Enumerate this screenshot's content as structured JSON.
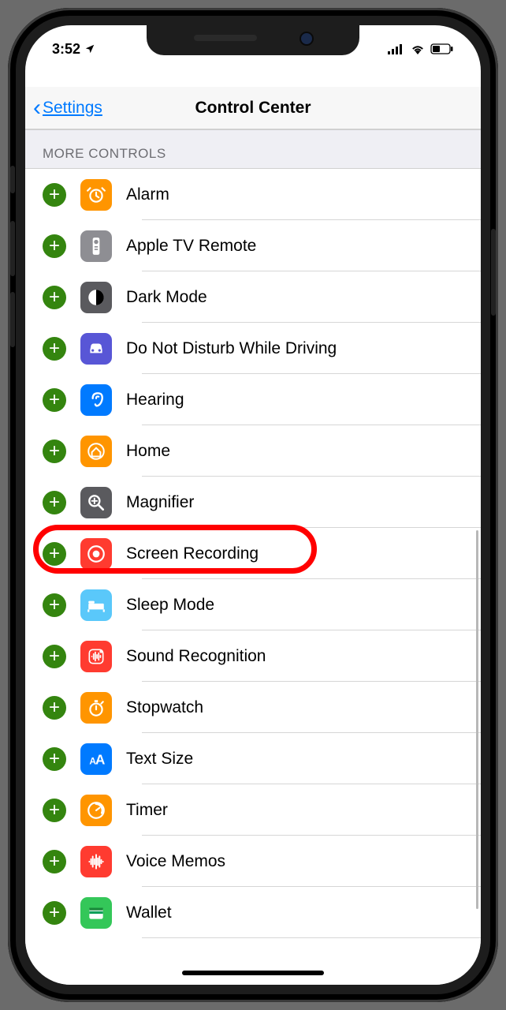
{
  "status": {
    "time": "3:52"
  },
  "nav": {
    "back_label": "Settings",
    "title": "Control Center"
  },
  "section": {
    "header": "MORE CONTROLS"
  },
  "controls": [
    {
      "label": "Alarm",
      "icon": "alarm",
      "bg": "bg-orange"
    },
    {
      "label": "Apple TV Remote",
      "icon": "remote",
      "bg": "bg-gray"
    },
    {
      "label": "Dark Mode",
      "icon": "darkmode",
      "bg": "bg-darkgray"
    },
    {
      "label": "Do Not Disturb While Driving",
      "icon": "car",
      "bg": "bg-purple"
    },
    {
      "label": "Hearing",
      "icon": "ear",
      "bg": "bg-blue"
    },
    {
      "label": "Home",
      "icon": "home",
      "bg": "bg-orange"
    },
    {
      "label": "Magnifier",
      "icon": "magnifier",
      "bg": "bg-darkgray"
    },
    {
      "label": "Screen Recording",
      "icon": "record",
      "bg": "bg-red",
      "highlighted": true
    },
    {
      "label": "Sleep Mode",
      "icon": "bed",
      "bg": "bg-lightblue"
    },
    {
      "label": "Sound Recognition",
      "icon": "sound",
      "bg": "bg-red"
    },
    {
      "label": "Stopwatch",
      "icon": "stopwatch",
      "bg": "bg-orange"
    },
    {
      "label": "Text Size",
      "icon": "textsize",
      "bg": "bg-blue"
    },
    {
      "label": "Timer",
      "icon": "timer",
      "bg": "bg-orange"
    },
    {
      "label": "Voice Memos",
      "icon": "voice",
      "bg": "bg-red"
    },
    {
      "label": "Wallet",
      "icon": "wallet",
      "bg": "bg-green"
    }
  ]
}
